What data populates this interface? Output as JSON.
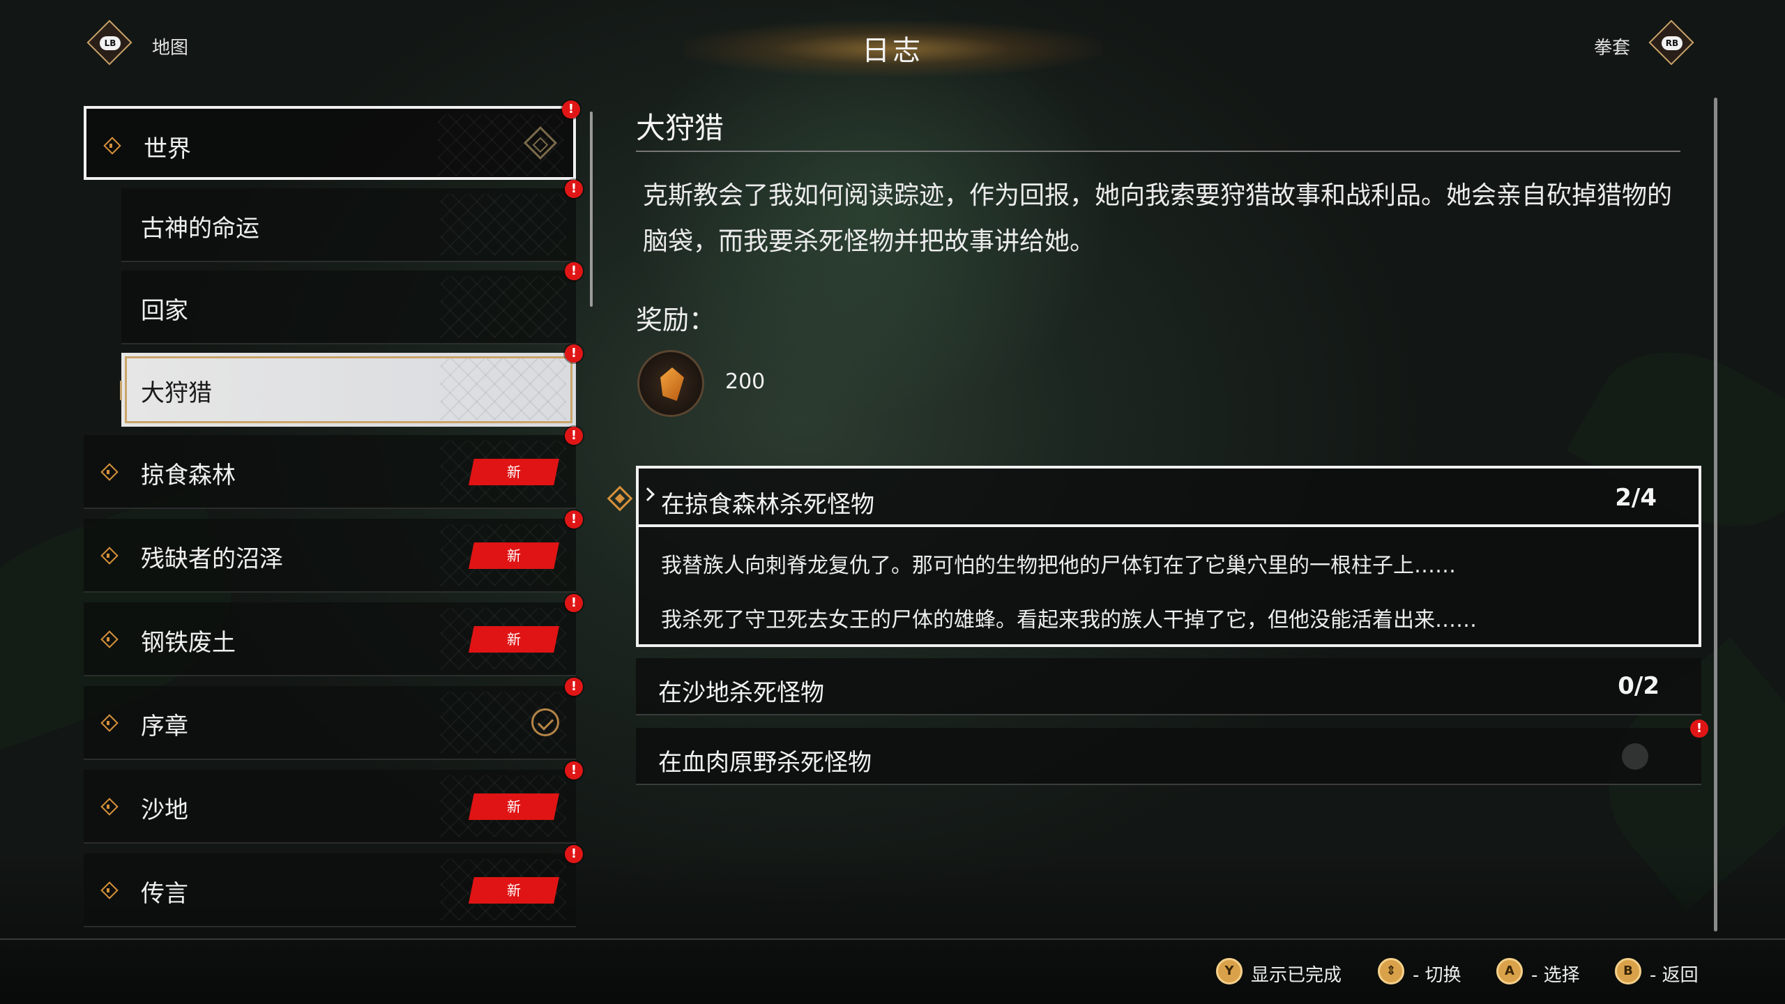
{
  "header": {
    "left_button": "LB",
    "left_label": "地图",
    "title": "日志",
    "right_label": "拳套",
    "right_button": "RB"
  },
  "categories": [
    {
      "label": "世界",
      "state": "active",
      "alert": "!"
    },
    {
      "label": "古神的命运",
      "state": "sub",
      "alert": "!"
    },
    {
      "label": "回家",
      "state": "sub",
      "alert": "!"
    },
    {
      "label": "大狩猎",
      "state": "sub-selected",
      "alert": "!"
    },
    {
      "label": "掠食森林",
      "state": "new",
      "badge": "新",
      "alert": "!"
    },
    {
      "label": "残缺者的沼泽",
      "state": "new",
      "badge": "新",
      "alert": "!"
    },
    {
      "label": "钢铁废土",
      "state": "new",
      "badge": "新",
      "alert": "!"
    },
    {
      "label": "序章",
      "state": "complete",
      "alert": "!"
    },
    {
      "label": "沙地",
      "state": "new",
      "badge": "新",
      "alert": "!"
    },
    {
      "label": "传言",
      "state": "new",
      "badge": "新",
      "alert": "!"
    }
  ],
  "detail": {
    "title": "大狩猎",
    "description": "克斯教会了我如何阅读踪迹，作为回报，她向我索要狩猎故事和战利品。她会亲自砍掉猎物的脑袋，而我要杀死怪物并把故事讲给她。",
    "reward_label": "奖励：",
    "reward_value": "200",
    "reward_icon": "amber-gem-icon",
    "objectives": [
      {
        "name": "在掠食森林杀死怪物",
        "count": "2/4",
        "expanded": true,
        "entries": [
          "我替族人向刺脊龙复仇了。那可怕的生物把他的尸体钉在了它巢穴里的一根柱子上……",
          "我杀死了守卫死去女王的尸体的雄蜂。看起来我的族人干掉了它，但他没能活着出来……"
        ]
      },
      {
        "name": "在沙地杀死怪物",
        "count": "0/2",
        "expanded": false
      },
      {
        "name": "在血肉原野杀死怪物",
        "count": "",
        "expanded": false,
        "alert": "!"
      }
    ]
  },
  "footer": {
    "hints": [
      {
        "button": "Y",
        "label": "显示已完成"
      },
      {
        "button": "⇕",
        "label": "- 切换"
      },
      {
        "button": "A",
        "label": "- 选择"
      },
      {
        "button": "B",
        "label": "- 返回"
      }
    ]
  },
  "colors": {
    "accent_gold": "#d6913a",
    "alert_red": "#e01616",
    "new_badge_red": "#e01414",
    "selected_bg": "#e6e6e6"
  }
}
